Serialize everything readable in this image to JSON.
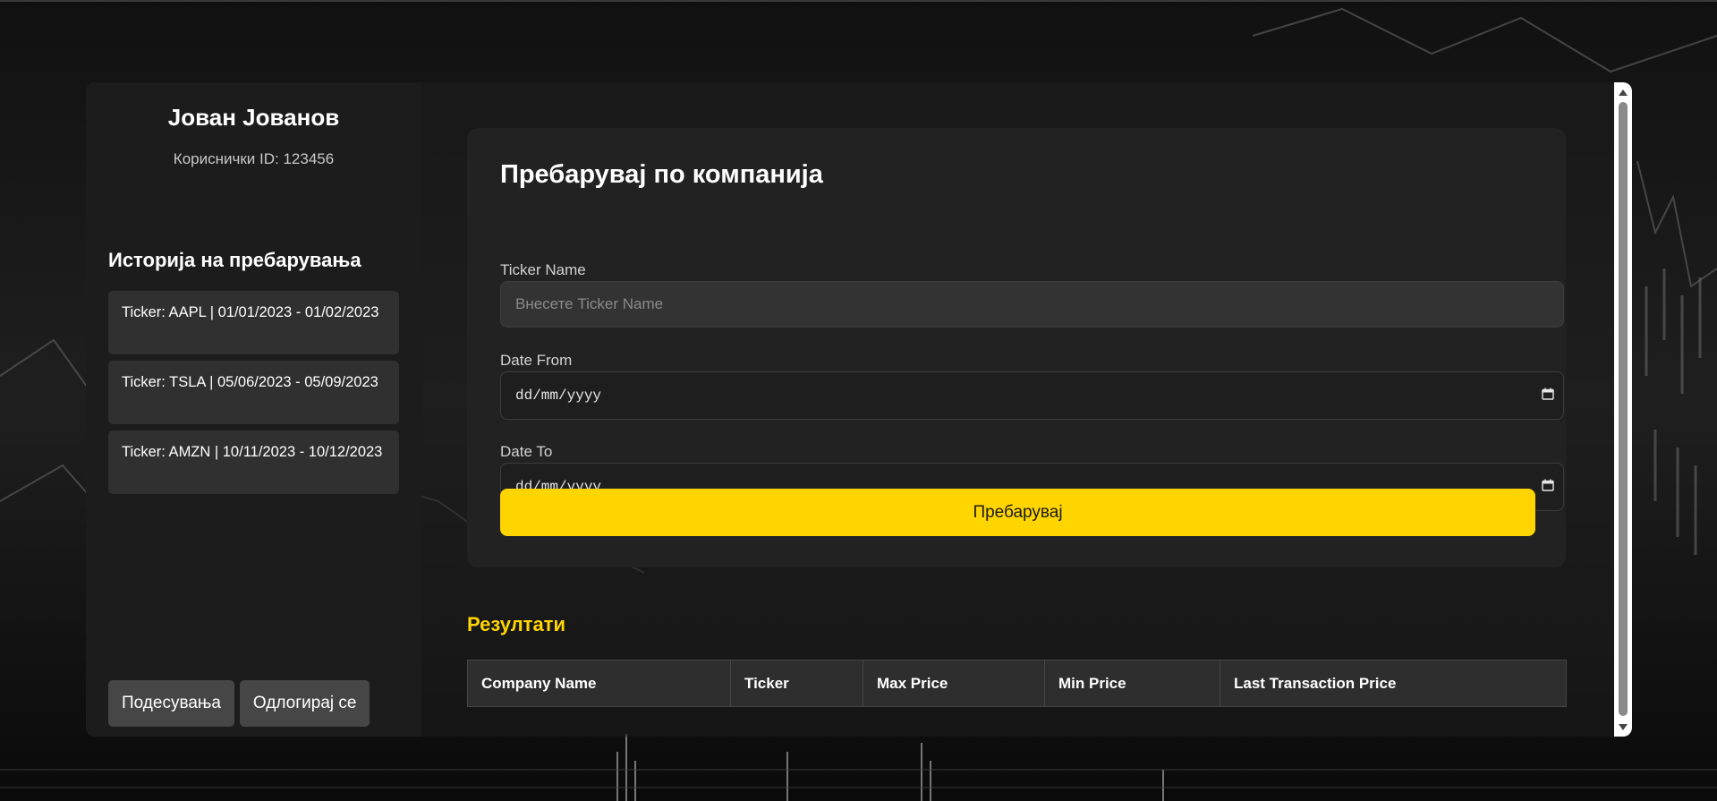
{
  "user": {
    "name": "Јован Јованов",
    "id_text": "Кориснички ID: 123456"
  },
  "history": {
    "title": "Историја на пребарувања",
    "items": [
      {
        "label": "Ticker: AAPL | 01/01/2023 - 01/02/2023"
      },
      {
        "label": "Ticker: TSLA | 05/06/2023 - 05/09/2023"
      },
      {
        "label": "Ticker: AMZN | 10/11/2023 - 10/12/2023"
      }
    ]
  },
  "sidebar_buttons": {
    "settings": "Подесувања",
    "logout": "Одлогирај се"
  },
  "search": {
    "title": "Пребарувај по компанија",
    "ticker_label": "Ticker Name",
    "ticker_placeholder": "Внесете Ticker Name",
    "ticker_value": "",
    "date_from_label": "Date From",
    "date_from_value": "dd/mm/yyyy",
    "date_to_label": "Date To",
    "date_to_value": "dd/mm/yyyy",
    "submit": "Пребарувај"
  },
  "results": {
    "title": "Резултати",
    "columns": [
      "Company Name",
      "Ticker",
      "Max Price",
      "Min Price",
      "Last Transaction Price"
    ],
    "rows": []
  },
  "icons": {
    "date_from": "calendar-icon",
    "date_to": "calendar-icon",
    "scroll_up": "chevron-up-icon",
    "scroll_down": "chevron-down-icon"
  },
  "colors": {
    "accent": "#ffd500",
    "panel": "#222222",
    "sidebar": "#1c1c1c",
    "history_item": "#303030"
  }
}
